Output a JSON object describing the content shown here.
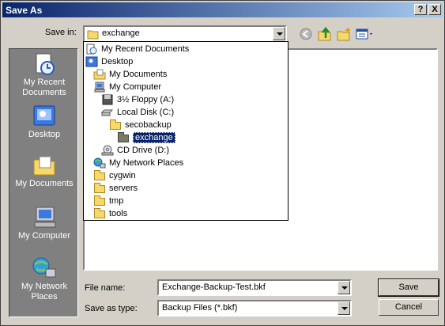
{
  "window": {
    "title": "Save As",
    "help_label": "?",
    "close_label": "X"
  },
  "save_in": {
    "label": "Save in:",
    "value": "exchange"
  },
  "dropdown_items": [
    {
      "label": "My Recent Documents",
      "icon": "recent-documents-icon"
    },
    {
      "label": "Desktop",
      "icon": "desktop-icon"
    },
    {
      "label": "My Documents",
      "icon": "my-documents-icon"
    },
    {
      "label": "My Computer",
      "icon": "my-computer-icon"
    },
    {
      "label": "3½ Floppy (A:)",
      "icon": "floppy-icon"
    },
    {
      "label": "Local Disk (C:)",
      "icon": "hard-disk-icon"
    },
    {
      "label": "secobackup",
      "icon": "folder-icon"
    },
    {
      "label": "exchange",
      "icon": "folder-open-icon",
      "selected": true
    },
    {
      "label": "CD Drive (D:)",
      "icon": "cd-drive-icon"
    },
    {
      "label": "My Network Places",
      "icon": "network-places-icon"
    },
    {
      "label": "cygwin",
      "icon": "folder-icon"
    },
    {
      "label": "servers",
      "icon": "folder-icon"
    },
    {
      "label": "tmp",
      "icon": "folder-icon"
    },
    {
      "label": "tools",
      "icon": "folder-icon"
    }
  ],
  "places": [
    {
      "label": "My Recent Documents",
      "icon": "recent-documents-icon"
    },
    {
      "label": "Desktop",
      "icon": "desktop-icon"
    },
    {
      "label": "My Documents",
      "icon": "my-documents-icon"
    },
    {
      "label": "My Computer",
      "icon": "my-computer-icon"
    },
    {
      "label": "My Network Places",
      "icon": "network-places-icon"
    }
  ],
  "file_name": {
    "label": "File name:",
    "value": "Exchange-Backup-Test.bkf"
  },
  "save_as_type": {
    "label": "Save as type:",
    "value": "Backup Files (*.bkf)"
  },
  "buttons": {
    "save": "Save",
    "cancel": "Cancel"
  },
  "colors": {
    "titlebar_start": "#0a246a",
    "titlebar_end": "#a6caf0",
    "selection": "#0a246a",
    "face": "#d4d0c8"
  }
}
